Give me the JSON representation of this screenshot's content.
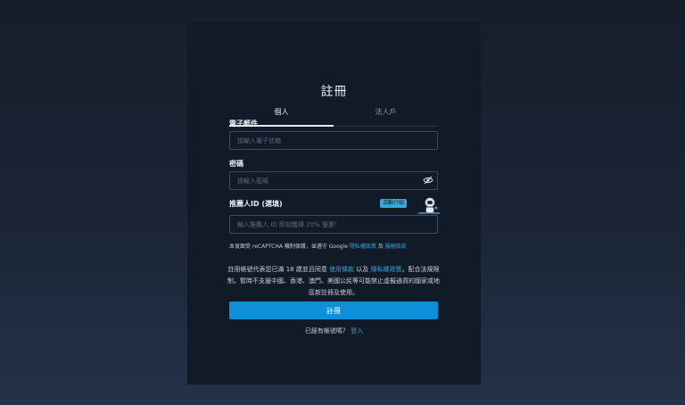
{
  "form": {
    "title": "註冊",
    "tabs": [
      {
        "label": "個人",
        "active": true
      },
      {
        "label": "法人戶",
        "active": false
      }
    ],
    "email": {
      "label": "電子郵件",
      "placeholder": "請輸入電子信箱"
    },
    "password": {
      "label": "密碼",
      "placeholder": "請輸入密碼",
      "toggle_icon": "eye-off-icon"
    },
    "referral": {
      "label": "推薦人ID (選填)",
      "placeholder": "輸入推薦人 ID 即刻獲得 20% 優惠！",
      "promo_badge": "活動介紹",
      "mascot_icon": "astronaut-icon"
    },
    "recaptcha": {
      "prefix": "本頁面受 reCAPTCHA 機制保護，並遵守 Google",
      "privacy_link": "隱私權政策",
      "and": "及",
      "terms_link": "服務條款"
    },
    "agreement": {
      "prefix": "註冊帳號代表您已滿 18 歲並且同意",
      "terms_link": "使用條款",
      "and": "以及",
      "privacy_link": "隱私權政策",
      "suffix": "，配合法規限制，暫時不支援中國、香港、澳門、美國公民等可能禁止虛擬通貨的國家或地區新註冊及使用。"
    },
    "submit_label": "註冊",
    "login": {
      "prompt": "已經有帳號嗎？",
      "link": "登入"
    }
  },
  "colors": {
    "accent": "#0d8fd9",
    "link": "#34a3dd",
    "card_bg": "#111a27"
  }
}
